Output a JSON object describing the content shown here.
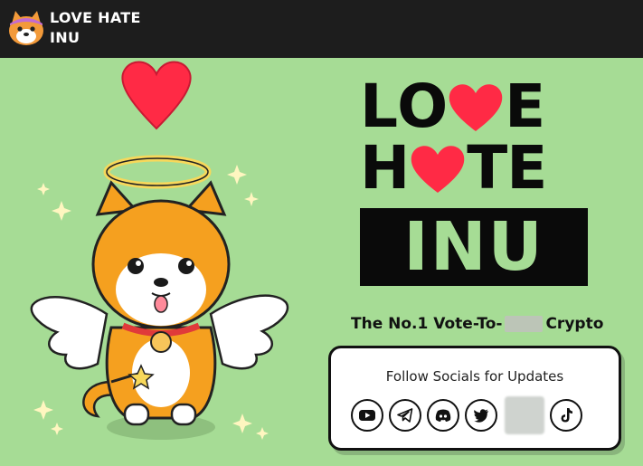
{
  "header": {
    "brand_line1": "LOVE HATE",
    "brand_line2": "INU",
    "logo_icon": "shiba-dog-head-icon"
  },
  "hero": {
    "title_line1": [
      "L",
      "O",
      "heart",
      "E"
    ],
    "title_line2": [
      "H",
      "heart",
      "T",
      "E"
    ],
    "title_line3": "INU",
    "tagline_start": "The No.1 Vote-To-",
    "tagline_end": "Crypto"
  },
  "socials": {
    "title": "Follow Socials for Updates",
    "icons": [
      "youtube-icon",
      "telegram-icon",
      "discord-icon",
      "twitter-icon",
      "blurred-icon",
      "tiktok-icon"
    ]
  },
  "colors": {
    "background": "#a6dc95",
    "header_bg": "#1d1d1d",
    "heart": "#ff2a45",
    "orange": "#f5a01f"
  }
}
